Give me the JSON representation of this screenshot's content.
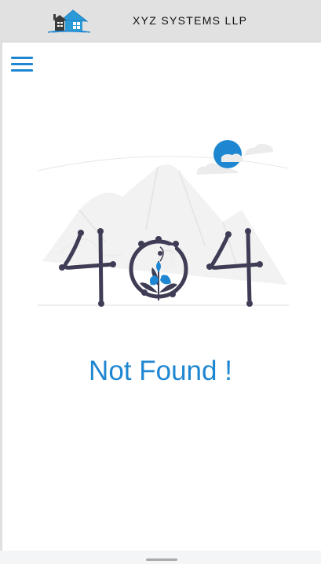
{
  "header": {
    "company_name": "XYZ SYSTEMS LLP",
    "logo_icon": "house-logo-icon"
  },
  "nav": {
    "menu_icon": "hamburger-menu-icon"
  },
  "error": {
    "code_digits": [
      "4",
      "0",
      "4"
    ],
    "message": "Not Found !"
  },
  "colors": {
    "accent": "#1f87d1",
    "header_bg": "#e1e1e1",
    "illustration_dark": "#3f3d56"
  }
}
